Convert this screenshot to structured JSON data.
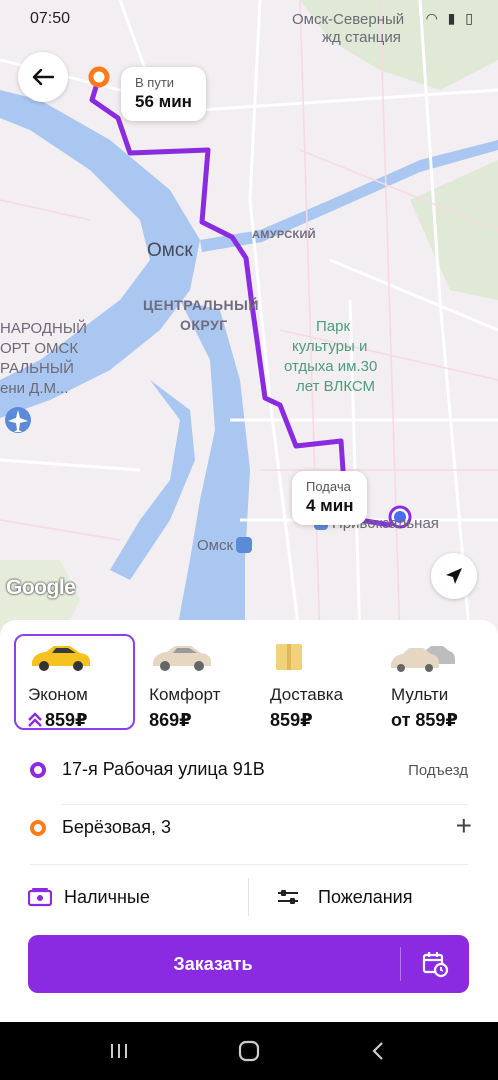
{
  "status": {
    "time": "07:50"
  },
  "map": {
    "labels": {
      "station": "Омск-Северный",
      "station2": "жд станция",
      "city": "Омск",
      "district1": "ЦЕНТРАЛЬНЫЙ",
      "district2": "ОКРУГ",
      "amursky": "АМУРСКИЙ",
      "park1": "Парк",
      "park2": "культуры и",
      "park3": "отдыха им.30",
      "park4": "лет ВЛКСМ",
      "airport1": "НАРОДНЫЙ",
      "airport2": "ОРТ ОМСК",
      "airport3": "РАЛЬНЫЙ",
      "airport4": "ени Д.М...",
      "omsk_station": "Омск",
      "street": "Привокзальная"
    },
    "bubble_trip": {
      "label": "В пути",
      "value": "56 мин"
    },
    "bubble_pickup": {
      "label": "Подача",
      "value": "4 мин"
    },
    "attribution": "Google"
  },
  "tariffs": [
    {
      "name": "Эконом",
      "price": "859₽",
      "selected": true,
      "surge": true
    },
    {
      "name": "Комфорт",
      "price": "869₽",
      "selected": false
    },
    {
      "name": "Доставка",
      "price": "859₽",
      "selected": false
    },
    {
      "name": "Мульти",
      "price": "от 859₽",
      "selected": false
    }
  ],
  "route": {
    "from": {
      "address": "17-я Рабочая улица 91В",
      "extra": "Подъезд"
    },
    "to": {
      "address": "Берёзовая, 3"
    }
  },
  "options": {
    "payment": "Наличные",
    "wishes": "Пожелания"
  },
  "order": {
    "label": "Заказать"
  },
  "colors": {
    "accent": "#8a2be2",
    "route": "#8a2be2",
    "destination": "#ff7a1a"
  }
}
